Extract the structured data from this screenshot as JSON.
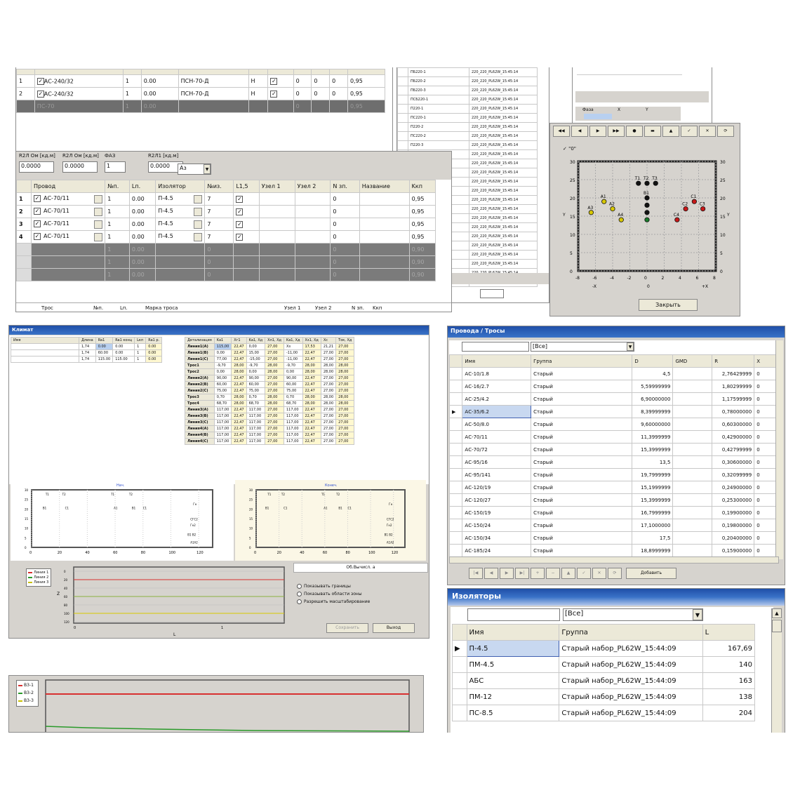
{
  "top_table": {
    "rows": [
      {
        "n": "1",
        "wire": "АС-240/32",
        "nn": "1",
        "l": "0.00",
        "ins": "ПСН-70-Д",
        "k": "Н",
        "c1": "0",
        "c2": "0",
        "c3": "0",
        "kp": "0,95"
      },
      {
        "n": "2",
        "wire": "АС-240/32",
        "nn": "1",
        "l": "0.00",
        "ins": "ПСН-70-Д",
        "k": "Н",
        "c1": "0",
        "c2": "0",
        "c3": "0",
        "kp": "0,95"
      },
      {
        "n": "",
        "wire": "ПС-70",
        "nn": "1",
        "l": "0.00",
        "ins": "",
        "k": "",
        "c1": "0",
        "c2": "",
        "c3": "",
        "kp": "0,95"
      }
    ]
  },
  "params": {
    "labels": [
      "R2Л Ом [кд.м]",
      "R2Л Ом [кд.м]",
      "ФАЗ",
      "R2Л1 [кд.м]"
    ],
    "values": [
      "0.0000",
      "0.0000",
      "1",
      "0.0000"
    ],
    "select": "Аз"
  },
  "wires_grid": {
    "headers": [
      "Провод",
      "№п.",
      "Lп.",
      "Изолятор",
      "№из.",
      "L1,5",
      "Узел 1",
      "Узел 2",
      "N зп.",
      "Название",
      "Kкп"
    ],
    "rows": [
      {
        "n": "1",
        "wire": "АС-70/11",
        "nn": "1",
        "l": "0.00",
        "ins": "П-4.5",
        "k": "7",
        "z": "0",
        "kp": "0,95"
      },
      {
        "n": "2",
        "wire": "АС-70/11",
        "nn": "1",
        "l": "0.00",
        "ins": "П-4.5",
        "k": "7",
        "z": "0",
        "kp": "0,95"
      },
      {
        "n": "3",
        "wire": "АС-70/11",
        "nn": "1",
        "l": "0.00",
        "ins": "П-4.5",
        "k": "7",
        "z": "0",
        "kp": "0,95"
      },
      {
        "n": "4",
        "wire": "АС-70/11",
        "nn": "1",
        "l": "0.00",
        "ins": "П-4.5",
        "k": "7",
        "z": "0",
        "kp": "0,95"
      }
    ],
    "dark_rows": [
      {
        "nn": "1",
        "l": "0.00",
        "k": "0",
        "z": "0",
        "kp": "0,90"
      },
      {
        "nn": "1",
        "l": "0.00",
        "k": "0",
        "z": "0",
        "kp": "0,90"
      },
      {
        "nn": "1",
        "l": "0.00",
        "k": "0",
        "z": "0",
        "kp": "0,90"
      }
    ],
    "footer": [
      "Трос",
      "№п.",
      "Lп.",
      "Марка троса",
      "Узел 1",
      "Узел 2",
      "N зп.",
      "Kкп"
    ]
  },
  "mid_list": {
    "rows": [
      [
        "ПБ220-1",
        "220_220_PL62W_15:45:14"
      ],
      [
        "ПБ220-2",
        "220_220_PL62W_15:45:14"
      ],
      [
        "ПБ220-3",
        "220_220_PL62W_15:45:14"
      ],
      [
        "ПСБ220-1",
        "220_220_PL62W_15:45:14"
      ],
      [
        "П220-1",
        "220_220_PL62W_15:45:14"
      ],
      [
        "ПС220-1",
        "220_220_PL62W_15:45:14"
      ],
      [
        "П220-2",
        "220_220_PL62W_15:45:14"
      ],
      [
        "ПС220-2",
        "220_220_PL62W_15:45:14"
      ],
      [
        "П220-3",
        "220_220_PL62W_15:45:14"
      ],
      [
        "",
        "220_220_PL62W_15:45:14"
      ],
      [
        "",
        "220_220_PL62W_15:45:14"
      ],
      [
        "",
        "220_220_PL62W_15:45:14"
      ],
      [
        "",
        "220_220_PL62W_15:45:14"
      ],
      [
        "",
        "220_220_PL62W_15:45:14"
      ],
      [
        "",
        "220_220_PL62W_15:45:14"
      ],
      [
        "",
        "220_220_PL62W_15:45:14"
      ],
      [
        "",
        "220_220_PL62W_15:45:14"
      ],
      [
        "",
        "220_220_PL62W_15:45:14"
      ],
      [
        "",
        "220_220_PL62W_15:45:14"
      ],
      [
        "",
        "220_220_PL62W_15:45:14"
      ],
      [
        "",
        "220_220_PL62W_15:45:14"
      ],
      [
        "",
        "220_220_PL62W_15:45:14"
      ],
      [
        "",
        "220_220_PL62W_15:45:14"
      ],
      [
        "",
        "220_220_PL62W_15:45:14"
      ]
    ]
  },
  "coord_window": {
    "top_labels": [
      "Фаза",
      "X",
      "Y"
    ],
    "check_label": "\"0\"",
    "close_button": "Закрыть",
    "x_ticks": [
      "-8",
      "-6",
      "-4",
      "-2",
      "0",
      "2",
      "4",
      "6",
      "8"
    ],
    "y_ticks": [
      "30",
      "25",
      "20",
      "15",
      "10",
      "5",
      "0"
    ],
    "x_axis_left": "-X",
    "x_axis_right": "+X",
    "x_axis_mid": "0",
    "y_axis": "Y",
    "points": [
      {
        "label": "T1",
        "x": -1,
        "y": 24,
        "color": "#111111"
      },
      {
        "label": "T2",
        "x": 0,
        "y": 24,
        "color": "#111111"
      },
      {
        "label": "T3",
        "x": 1,
        "y": 24,
        "color": "#111111"
      },
      {
        "label": "A1",
        "x": -5,
        "y": 19,
        "color": "#d8c800"
      },
      {
        "label": "A2",
        "x": -4,
        "y": 17,
        "color": "#d8c800"
      },
      {
        "label": "A3",
        "x": -6.5,
        "y": 16,
        "color": "#d8c800"
      },
      {
        "label": "A4",
        "x": -3,
        "y": 14,
        "color": "#d8c800"
      },
      {
        "label": "B1",
        "x": 0,
        "y": 20,
        "color": "#111111"
      },
      {
        "label": "",
        "x": 0,
        "y": 18,
        "color": "#111111"
      },
      {
        "label": "",
        "x": 0,
        "y": 16,
        "color": "#111111"
      },
      {
        "label": "",
        "x": 0,
        "y": 14,
        "color": "#1a7a2a"
      },
      {
        "label": "C1",
        "x": 5.5,
        "y": 19,
        "color": "#c81818"
      },
      {
        "label": "C2",
        "x": 4.5,
        "y": 17,
        "color": "#c81818"
      },
      {
        "label": "C3",
        "x": 6.5,
        "y": 17,
        "color": "#c81818"
      },
      {
        "label": "C4",
        "x": 3.5,
        "y": 14,
        "color": "#c81818"
      }
    ]
  },
  "calc_window": {
    "title": "Климат",
    "left_headers": [
      "Имя",
      "Длина",
      "Ra1",
      "Ra1 конц",
      "Lкп",
      "Ra1 р."
    ],
    "left_rows": [
      [
        "",
        "1,74",
        "0.00",
        "0.00",
        "1",
        "0.00"
      ],
      [
        "",
        "1,74",
        "60.00",
        "0.00",
        "1",
        "0.00"
      ],
      [
        "",
        "1,74",
        "115.00",
        "115.00",
        "1",
        "0.00"
      ]
    ],
    "right_headers": [
      "Детализация",
      "Ka1",
      "Xг1",
      "Ka1, Xд",
      "Xл1, Xд",
      "Ka1, Xд",
      "Xз1, Xд",
      "Хс",
      "Ток, Xд",
      "Хсос, Xд"
    ],
    "right_rows": [
      [
        "Линия1(A)",
        "115,00",
        "22,47",
        "0,00",
        "27,00",
        "Хз",
        "17,53",
        "21,21",
        "27,00"
      ],
      [
        "Линия1(B)",
        "0,00",
        "22,47",
        "15,00",
        "27,00",
        "-11,00",
        "22,47",
        "27,00",
        "27,00"
      ],
      [
        "Линия1(C)",
        "77,00",
        "22,47",
        "-15,00",
        "27,00",
        "-11,00",
        "22,47",
        "27,00",
        "27,00"
      ],
      [
        "Трос1",
        "-9,70",
        "28,00",
        "-9,70",
        "28,00",
        "-9,70",
        "28,00",
        "28,00",
        "28,00"
      ],
      [
        "Трос2",
        "0,00",
        "28,00",
        "0,00",
        "28,00",
        "0,00",
        "28,00",
        "28,00",
        "28,00"
      ],
      [
        "Линия2(A)",
        "90,00",
        "22,47",
        "90,00",
        "27,00",
        "90,00",
        "22,47",
        "27,00",
        "27,00"
      ],
      [
        "Линия2(B)",
        "60,00",
        "22,47",
        "60,00",
        "27,00",
        "60,00",
        "22,47",
        "27,00",
        "27,00"
      ],
      [
        "Линия2(C)",
        "75,00",
        "22,47",
        "75,00",
        "27,00",
        "75,00",
        "22,47",
        "27,00",
        "27,00"
      ],
      [
        "Трос3",
        "0,70",
        "28,00",
        "0,70",
        "28,00",
        "0,70",
        "28,00",
        "28,00",
        "28,00"
      ],
      [
        "Трос4",
        "68,70",
        "28,00",
        "68,70",
        "28,00",
        "68,70",
        "28,00",
        "28,00",
        "28,00"
      ],
      [
        "Линия3(A)",
        "117,00",
        "22,47",
        "117,00",
        "27,00",
        "117,00",
        "22,47",
        "27,00",
        "27,00"
      ],
      [
        "Линия3(B)",
        "117,00",
        "22,47",
        "117,00",
        "27,00",
        "117,00",
        "22,47",
        "27,00",
        "27,00"
      ],
      [
        "Линия3(C)",
        "117,00",
        "22,47",
        "117,00",
        "27,00",
        "117,00",
        "22,47",
        "27,00",
        "27,00"
      ],
      [
        "Линия4(A)",
        "117,00",
        "22,47",
        "117,00",
        "27,00",
        "117,00",
        "22,47",
        "27,00",
        "27,00"
      ],
      [
        "Линия4(B)",
        "117,00",
        "22,47",
        "117,00",
        "27,00",
        "117,00",
        "22,47",
        "27,00",
        "27,00"
      ],
      [
        "Линия4(C)",
        "117,00",
        "22,47",
        "117,00",
        "27,00",
        "117,00",
        "22,47",
        "27,00",
        "27,00"
      ]
    ],
    "plot1_title": "Нач.",
    "plot2_title": "Конеч.",
    "plot_xticks": [
      "0",
      "20",
      "40",
      "60",
      "80",
      "100",
      "120"
    ],
    "plot_yticks": [
      "30",
      "25",
      "20",
      "15",
      "10",
      "5",
      "0"
    ],
    "plot1_labels": [
      {
        "t": "T1",
        "x": 10,
        "y": 27
      },
      {
        "t": "T2",
        "x": 22,
        "y": 27
      },
      {
        "t": "T1",
        "x": 57,
        "y": 27
      },
      {
        "t": "T2",
        "x": 70,
        "y": 27
      },
      {
        "t": "B1",
        "x": 8,
        "y": 20
      },
      {
        "t": "C1",
        "x": 24,
        "y": 20
      },
      {
        "t": "A1",
        "x": 59,
        "y": 20
      },
      {
        "t": "B1",
        "x": 72,
        "y": 20
      },
      {
        "t": "C1",
        "x": 80,
        "y": 20
      },
      {
        "t": "Гн",
        "x": 116,
        "y": 22
      },
      {
        "t": "СГС2",
        "x": 114,
        "y": 14
      },
      {
        "t": "Гн2",
        "x": 114,
        "y": 11
      },
      {
        "t": "В1  В2",
        "x": 112,
        "y": 6
      },
      {
        "t": "А1А2",
        "x": 114,
        "y": 2
      }
    ],
    "plot2_labels": [
      {
        "t": "T1",
        "x": 10,
        "y": 27
      },
      {
        "t": "T2",
        "x": 22,
        "y": 27
      },
      {
        "t": "T1",
        "x": 57,
        "y": 27
      },
      {
        "t": "T2",
        "x": 70,
        "y": 27
      },
      {
        "t": "B1",
        "x": 8,
        "y": 20
      },
      {
        "t": "C1",
        "x": 24,
        "y": 20
      },
      {
        "t": "A1",
        "x": 59,
        "y": 20
      },
      {
        "t": "B1",
        "x": 72,
        "y": 20
      },
      {
        "t": "C1",
        "x": 80,
        "y": 20
      },
      {
        "t": "Гн",
        "x": 116,
        "y": 22
      },
      {
        "t": "СГС2",
        "x": 114,
        "y": 14
      },
      {
        "t": "Гн2",
        "x": 114,
        "y": 11
      },
      {
        "t": "В1  В2",
        "x": 112,
        "y": 6
      },
      {
        "t": "А1А2",
        "x": 114,
        "y": 2
      }
    ],
    "bottom_legend": [
      "Линия 1",
      "Линия 2",
      "Линия 3"
    ],
    "bottom_yticks": [
      "0",
      "20",
      "40",
      "60",
      "80",
      "100",
      "120"
    ],
    "bottom_xticks": [
      "0",
      "1"
    ],
    "bottom_ylabel": "Z",
    "bottom_xlabel": "L",
    "bottom_right_header": "Об.Вычисл. а",
    "options": [
      "Показывать границы",
      "Показывать области зоны",
      "Разрешить масштабирование"
    ],
    "btn_save": "Сохранить",
    "btn_exit": "Выход"
  },
  "bottom_chart": {
    "legend": [
      "В3-1",
      "В3-2",
      "В3-3"
    ],
    "colors": [
      "#d83030",
      "#2a9a2a",
      "#c8c000"
    ]
  },
  "wires_window": {
    "title": "Провода / Тросы",
    "filter_select": "[Все]",
    "headers": [
      "Имя",
      "Группа",
      "D",
      "GMD",
      "R",
      "X"
    ],
    "rows": [
      [
        "АС-10/1.8",
        "Старый",
        "4,5",
        "",
        "2,76429999",
        "0"
      ],
      [
        "АС-16/2.7",
        "Старый",
        "5,59999999",
        "",
        "1,80299999",
        "0"
      ],
      [
        "АС-25/4.2",
        "Старый",
        "6,90000000",
        "",
        "1,17599999",
        "0"
      ],
      [
        "АС-35/6.2",
        "Старый",
        "8,39999999",
        "",
        "0,78000000",
        "0"
      ],
      [
        "АС-50/8.0",
        "Старый",
        "9,60000000",
        "",
        "0,60300000",
        "0"
      ],
      [
        "АС-70/11",
        "Старый",
        "11,3999999",
        "",
        "0,42900000",
        "0"
      ],
      [
        "АС-70/72",
        "Старый",
        "15,3999999",
        "",
        "0,42799999",
        "0"
      ],
      [
        "АС-95/16",
        "Старый",
        "13,5",
        "",
        "0,30600000",
        "0"
      ],
      [
        "АС-95/141",
        "Старый",
        "19,7999999",
        "",
        "0,32099999",
        "0"
      ],
      [
        "АС-120/19",
        "Старый",
        "15,1999999",
        "",
        "0,24900000",
        "0"
      ],
      [
        "АС-120/27",
        "Старый",
        "15,3999999",
        "",
        "0,25300000",
        "0"
      ],
      [
        "АС-150/19",
        "Старый",
        "16,7999999",
        "",
        "0,19900000",
        "0"
      ],
      [
        "АС-150/24",
        "Старый",
        "17,1000000",
        "",
        "0,19800000",
        "0"
      ],
      [
        "АС-150/34",
        "Старый",
        "17,5",
        "",
        "0,20400000",
        "0"
      ],
      [
        "АС-185/24",
        "Старый",
        "18,8999999",
        "",
        "0,15900000",
        "0"
      ]
    ],
    "selected_index": 3,
    "bottom_button": "Добавить"
  },
  "insulators": {
    "title": "Изоляторы",
    "filter_select": "[Все]",
    "headers": [
      "Имя",
      "Группа",
      "L"
    ],
    "rows": [
      [
        "П-4.5",
        "Старый набор_PL62W_15:44:09",
        "167,69"
      ],
      [
        "ПМ-4.5",
        "Старый набор_PL62W_15:44:09",
        "140"
      ],
      [
        "АБС",
        "Старый набор_PL62W_15:44:09",
        "163"
      ],
      [
        "ПМ-12",
        "Старый набор_PL62W_15:44:09",
        "138"
      ],
      [
        "ПС-8.5",
        "Старый набор_PL62W_15:44:09",
        "204"
      ]
    ]
  }
}
